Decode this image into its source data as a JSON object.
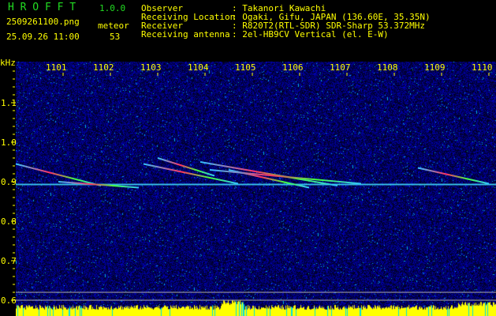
{
  "header": {
    "app": "H R O F F T",
    "version": "1.0.0",
    "filename": "2509261100.png",
    "datetime": "25.09.26 11:00",
    "meteor_label": "meteor",
    "meteor_count": "53"
  },
  "info": [
    {
      "label": "Observer",
      "value": ": Takanori Kawachi"
    },
    {
      "label": "Receiving Location",
      "value": ": Ogaki, Gifu, JAPAN (136.60E, 35.35N)"
    },
    {
      "label": "Receiver",
      "value": ": R820T2(RTL-SDR) SDR-Sharp 53.372MHz"
    },
    {
      "label": "Receiving antenna",
      "value": ": 2el-HB9CV Vertical (el. E-W)"
    }
  ],
  "chart_data": {
    "type": "heatmap",
    "ylabel": "kHz",
    "xlim": [
      1100,
      1110.15
    ],
    "ylim": [
      0.56,
      1.2
    ],
    "x_ticks": [
      "1101",
      "1102",
      "1103",
      "1104",
      "1105",
      "1106",
      "1107",
      "1108",
      "1109",
      "1110"
    ],
    "y_ticks": [
      "1.1",
      "1.0",
      "0.9",
      "0.8",
      "0.7",
      "0.6"
    ],
    "carrier_khz": 0.893,
    "traces": [
      {
        "t": [
          1100.0,
          1101.8
        ],
        "f": [
          0.945,
          0.89
        ]
      },
      {
        "t": [
          1100.9,
          1102.6
        ],
        "f": [
          0.9,
          0.885
        ]
      },
      {
        "t": [
          1102.7,
          1104.7
        ],
        "f": [
          0.945,
          0.895
        ]
      },
      {
        "t": [
          1103.0,
          1104.2
        ],
        "f": [
          0.96,
          0.915
        ]
      },
      {
        "t": [
          1103.9,
          1106.8
        ],
        "f": [
          0.95,
          0.89
        ]
      },
      {
        "t": [
          1104.1,
          1107.3
        ],
        "f": [
          0.93,
          0.895
        ]
      },
      {
        "t": [
          1104.5,
          1106.2
        ],
        "f": [
          0.93,
          0.885
        ]
      },
      {
        "t": [
          1108.5,
          1110.0
        ],
        "f": [
          0.935,
          0.895
        ]
      }
    ]
  }
}
